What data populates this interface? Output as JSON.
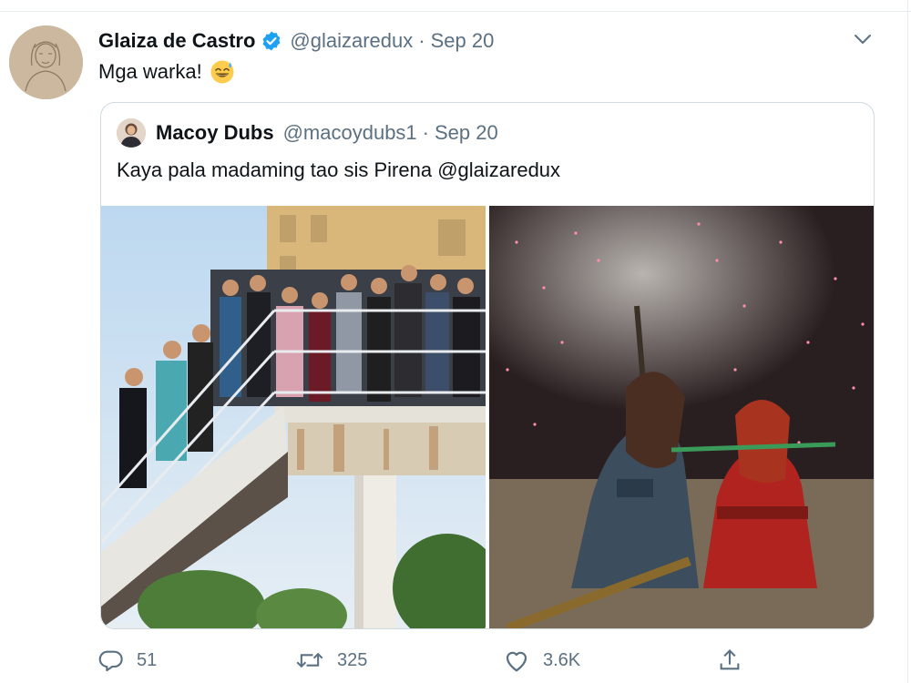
{
  "tweet": {
    "author_name": "Glaiza de Castro",
    "handle": "@glaizaredux",
    "separator": "·",
    "date": "Sep 20",
    "text": "Mga warka!",
    "emoji_icon": "grinning-sweat-emoji",
    "verified_color": "#1da1f2"
  },
  "quoted_tweet": {
    "author_name": "Macoy Dubs",
    "handle": "@macoydubs1",
    "separator": "·",
    "date": "Sep 20",
    "text": "Kaya pala madaming tao sis Pirena @glaizaredux"
  },
  "actions": {
    "reply_count": "51",
    "retweet_count": "325",
    "like_count": "3.6K"
  },
  "colors": {
    "secondary_text": "#5b7083",
    "border": "#cfd9de"
  }
}
